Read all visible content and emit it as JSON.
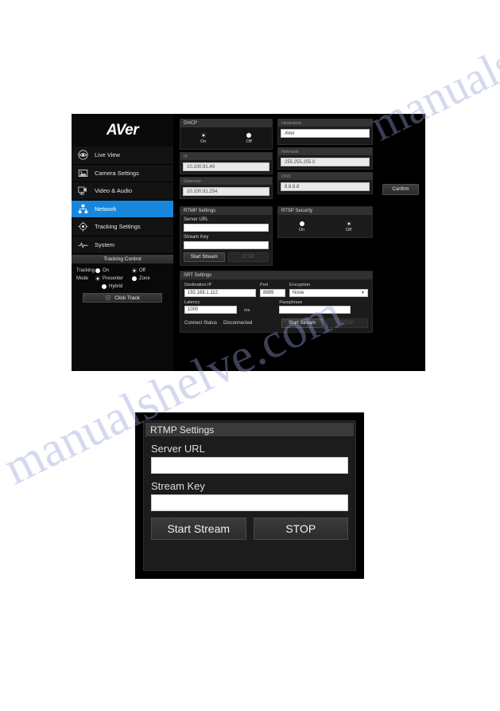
{
  "watermark": {
    "line1": "manualshelve.com",
    "line2": "manualshelve.com"
  },
  "app": {
    "logo": "AVer",
    "sidebar": {
      "items": [
        {
          "label": "Live View",
          "icon": "eye-icon",
          "active": false
        },
        {
          "label": "Camera Settings",
          "icon": "camera-icon",
          "active": false
        },
        {
          "label": "Video & Audio",
          "icon": "video-icon",
          "active": false
        },
        {
          "label": "Network",
          "icon": "network-icon",
          "active": true
        },
        {
          "label": "Tracking Settings",
          "icon": "target-icon",
          "active": false
        },
        {
          "label": "System",
          "icon": "pulse-icon",
          "active": false
        }
      ]
    },
    "tracking_control": {
      "header": "Tracking Control",
      "tracking_label": "Tracking",
      "tracking_options": [
        {
          "label": "On",
          "selected": false
        },
        {
          "label": "Off",
          "selected": true
        }
      ],
      "mode_label": "Mode",
      "mode_options": [
        {
          "label": "Presenter",
          "selected": true
        },
        {
          "label": "Zone",
          "selected": false
        },
        {
          "label": "Hybrid",
          "selected": false
        }
      ],
      "click_track_label": "Click Track"
    },
    "network": {
      "dhcp": {
        "title": "DHCP",
        "options": [
          {
            "label": "On",
            "selected": true
          },
          {
            "label": "Off",
            "selected": false
          }
        ]
      },
      "hostname": {
        "label": "Hostname",
        "value": "AVer"
      },
      "ip": {
        "label": "IP",
        "value": "10.100.91.49"
      },
      "netmask": {
        "label": "Netmask",
        "value": "255.255.255.0"
      },
      "gateway": {
        "label": "Gateway",
        "value": "10.100.91.254"
      },
      "dns": {
        "label": "DNS",
        "value": "8.8.8.8"
      },
      "confirm_label": "Confirm"
    },
    "rtmp": {
      "title": "RTMP Settings",
      "server_url_label": "Server URL",
      "server_url_value": "",
      "stream_key_label": "Stream Key",
      "stream_key_value": "",
      "start_label": "Start Stream",
      "stop_label": "STOP"
    },
    "rtsp": {
      "title": "RTSP Security",
      "options": [
        {
          "label": "On",
          "selected": false
        },
        {
          "label": "Off",
          "selected": true
        }
      ]
    },
    "srt": {
      "title": "SRT Settings",
      "destination_ip_label": "Destination IP",
      "destination_ip_value": "192.168.1.112",
      "port_label": "Port",
      "port_value": "8889",
      "encryption_label": "Encryption",
      "encryption_value": "None",
      "latency_label": "Latency",
      "latency_value": "1000",
      "latency_unit": "ms",
      "passphrase_label": "Passphrase",
      "passphrase_value": "",
      "connect_status_label": "Connect Status",
      "connect_status_value": "Disconnected",
      "start_label": "Start Stream",
      "stop_label": "STOP"
    }
  },
  "dialog": {
    "title": "RTMP Settings",
    "server_url_label": "Server URL",
    "server_url_value": "",
    "stream_key_label": "Stream Key",
    "stream_key_value": "",
    "start_label": "Start Stream",
    "stop_label": "STOP"
  }
}
